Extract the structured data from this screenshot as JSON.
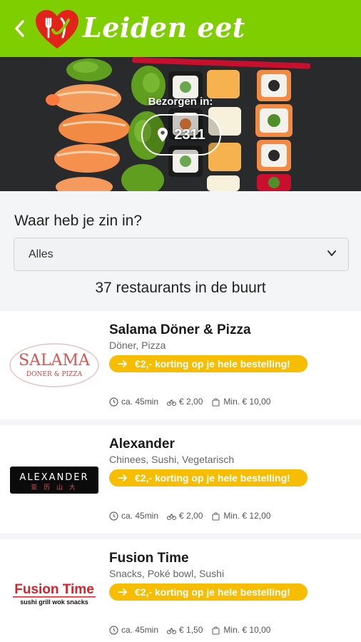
{
  "header": {
    "brand": "Leiden eet",
    "back_icon": "chevron-left-icon",
    "logo_icon": "heart-fork-knife-logo",
    "accent_color": "#7fcf00"
  },
  "hero": {
    "deliver_label": "Bezorgen in:",
    "postcode": "2311",
    "pin_icon": "location-pin-icon"
  },
  "filter": {
    "question": "Waar heb je zin in?",
    "selected": "Alles"
  },
  "results": {
    "count_text": "37 restaurants in de buurt"
  },
  "restaurants": [
    {
      "name": "Salama Döner & Pizza",
      "cuisine": "Döner, Pizza",
      "promo": "€2,- korting op je hele bestelling!",
      "time": "ca. 45min",
      "delivery": "€ 2,00",
      "min": "Min. € 10,00",
      "logo_text": "SALAMA",
      "logo_sub": "DONER & PIZZA"
    },
    {
      "name": "Alexander",
      "cuisine": "Chinees, Sushi, Vegetarisch",
      "promo": "€2,- korting op je hele bestelling!",
      "time": "ca. 45min",
      "delivery": "€ 2,00",
      "min": "Min. € 12,00",
      "logo_text": "ALEXANDER",
      "logo_sub": "亚 历 山 大"
    },
    {
      "name": "Fusion Time",
      "cuisine": "Snacks, Poké bowl, Sushi",
      "promo": "€2,- korting op je hele bestelling!",
      "time": "ca. 45min",
      "delivery": "€ 1,50",
      "min": "Min. € 10,00",
      "logo_text": "Fusion Time",
      "logo_sub": "sushi grill wok snacks"
    }
  ],
  "colors": {
    "promo": "#f7bd00",
    "background": "#f4f5f7"
  }
}
